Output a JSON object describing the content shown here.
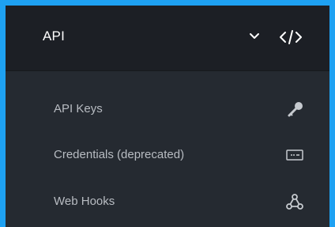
{
  "panel": {
    "title": "API",
    "header_icons": [
      "chevron-down-icon",
      "code-icon"
    ],
    "items": [
      {
        "label": "API Keys",
        "icon": "key-icon"
      },
      {
        "label": "Credentials (deprecated)",
        "icon": "credentials-card-icon"
      },
      {
        "label": "Web Hooks",
        "icon": "webhook-icon"
      }
    ]
  },
  "colors": {
    "frame_border": "#1ea1f2",
    "header_bg": "#1c1f25",
    "panel_bg": "#252a31",
    "title_text": "#ffffff",
    "item_text": "#b8bcc2",
    "icon": "#c6cacf"
  }
}
